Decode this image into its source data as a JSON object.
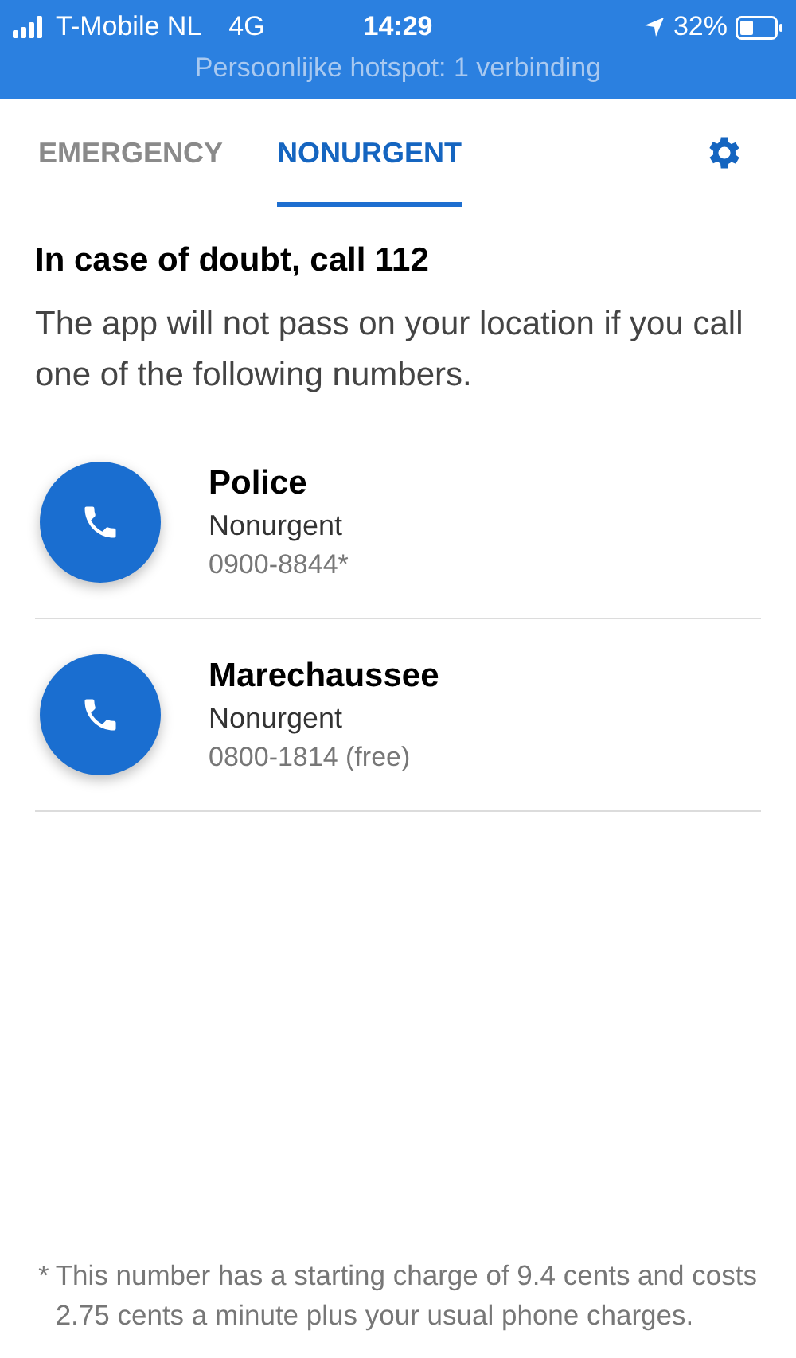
{
  "status_bar": {
    "carrier": "T-Mobile NL",
    "network": "4G",
    "time": "14:29",
    "battery": "32%",
    "hotspot": "Persoonlijke hotspot: 1 verbinding"
  },
  "tabs": [
    {
      "label": "EMERGENCY",
      "selected": false
    },
    {
      "label": "NONURGENT",
      "selected": true
    }
  ],
  "heading": "In case of doubt, call 112",
  "intro": "The app will not pass on your location if you call one of the following numbers.",
  "contacts": [
    {
      "name": "Police",
      "type": "Nonurgent",
      "number": "0900-8844*"
    },
    {
      "name": "Marechaussee",
      "type": "Nonurgent",
      "number": "0800-1814 (free)"
    }
  ],
  "footnote": {
    "marker": "*",
    "text": "This number has a starting charge of 9.4 cents and costs 2.75 cents a minute plus your usual phone charges."
  }
}
